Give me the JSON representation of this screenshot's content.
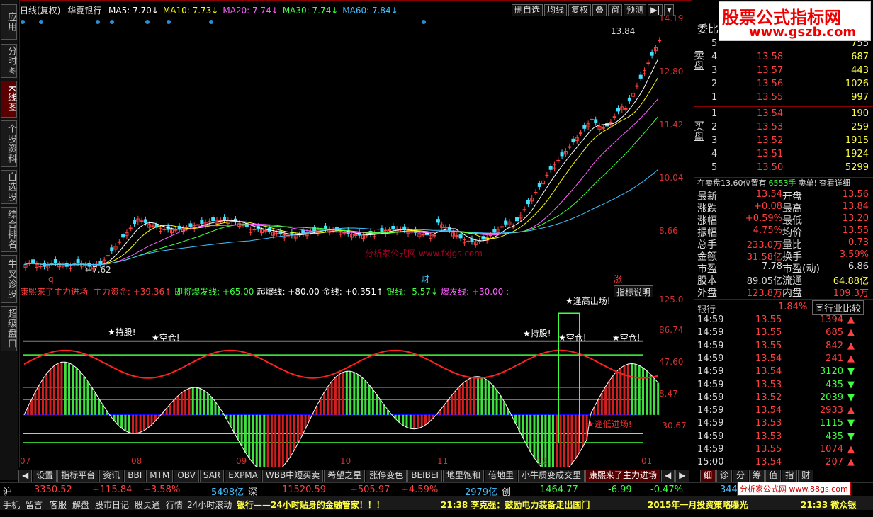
{
  "left_bar": [
    "应用",
    "分时图",
    "K线图",
    "个股资料",
    "自选股",
    "综合排名",
    "牛叉诊股",
    "超级盘口"
  ],
  "header": {
    "period": "日线(复权)",
    "stock_name": "华夏银行",
    "ma": [
      {
        "label": "MA5: 7.70↓",
        "color": "#ffffff"
      },
      {
        "label": "MA10: 7.73↓",
        "color": "#ffff00"
      },
      {
        "label": "MA20: 7.74↓",
        "color": "#ff60ff"
      },
      {
        "label": "MA30: 7.74↓",
        "color": "#40ff40"
      },
      {
        "label": "MA60: 7.84↓",
        "color": "#40c0ff"
      }
    ]
  },
  "toolbar": [
    "删自选",
    "均线",
    "复权",
    "叠",
    "窗",
    "预测"
  ],
  "price_axis": [
    "14.19",
    "12.80",
    "11.42",
    "10.04",
    "8.66"
  ],
  "price_labels": {
    "high": "13.84",
    "low": "7.62"
  },
  "event_markers": [
    "q",
    "财",
    "涨"
  ],
  "indicator": {
    "name": "康熙来了主力进场",
    "items": [
      {
        "label": "主力资金: +39.36↑",
        "color": "#ff4040"
      },
      {
        "label": "即将爆发线: +65.00",
        "color": "#40ff40"
      },
      {
        "label": "起爆线: +80.00",
        "color": "#ffffff"
      },
      {
        "label": "金线: +0.351↑",
        "color": "#ffffff"
      },
      {
        "label": "银线: -5.57↓",
        "color": "#40ff40"
      },
      {
        "label": "爆发线: +30.00 ;",
        "color": "#ff60ff"
      }
    ],
    "button": "指标说明",
    "axis": [
      "125.0",
      "86.74",
      "47.60",
      "8.47",
      "-30.67"
    ],
    "annotations": [
      "★逢高出场!",
      "★空仓!",
      "★空仓!",
      "★空仓!",
      "★逢低进场!",
      "★持股!",
      "★持股!"
    ]
  },
  "months": [
    "07",
    "08",
    "09",
    "10",
    "11",
    "12",
    "01"
  ],
  "watermark_mid": "分析家公式网 www.fxjgs.com",
  "order_book": {
    "header": "委比",
    "sell_label": "卖盘",
    "buy_label": "买盘",
    "sell": [
      {
        "n": "5",
        "p": "",
        "v": "755"
      },
      {
        "n": "4",
        "p": "13.58",
        "v": "687"
      },
      {
        "n": "3",
        "p": "13.57",
        "v": "443"
      },
      {
        "n": "2",
        "p": "13.56",
        "v": "1026"
      },
      {
        "n": "1",
        "p": "13.55",
        "v": "997"
      }
    ],
    "buy": [
      {
        "n": "1",
        "p": "13.54",
        "v": "190"
      },
      {
        "n": "2",
        "p": "13.53",
        "v": "259"
      },
      {
        "n": "3",
        "p": "13.52",
        "v": "1915"
      },
      {
        "n": "4",
        "p": "13.51",
        "v": "1924"
      },
      {
        "n": "5",
        "p": "13.50",
        "v": "5299"
      }
    ],
    "note_a": "在卖盘13.60位置有",
    "note_b": "6553手",
    "note_c": "卖单!",
    "note_d": "查看详细"
  },
  "quote": [
    [
      "最新",
      "13.54",
      "开盘",
      "13.56"
    ],
    [
      "涨跌",
      "+0.08",
      "最高",
      "13.84"
    ],
    [
      "涨幅",
      "+0.59%",
      "最低",
      "13.20"
    ],
    [
      "振幅",
      "4.75%",
      "均价",
      "13.55"
    ],
    [
      "总手",
      "233.0万",
      "量比",
      "0.73"
    ],
    [
      "金额",
      "31.58亿",
      "换手",
      "3.59%"
    ],
    [
      "市盈",
      "7.78",
      "市盈(动)",
      "6.86"
    ],
    [
      "股本",
      "89.05亿",
      "流通",
      "64.88亿"
    ],
    [
      "外盘",
      "123.8万",
      "内盘",
      "109.3万"
    ]
  ],
  "sector": {
    "name": "银行",
    "pct": "1.84%",
    "btn": "同行业比较"
  },
  "ticks": [
    [
      "14:59",
      "13.55",
      "1394"
    ],
    [
      "14:59",
      "13.55",
      "685"
    ],
    [
      "14:59",
      "13.55",
      "842"
    ],
    [
      "14:59",
      "13.54",
      "241"
    ],
    [
      "14:59",
      "13.54",
      "3120"
    ],
    [
      "14:59",
      "13.53",
      "435"
    ],
    [
      "14:59",
      "13.52",
      "2039"
    ],
    [
      "14:59",
      "13.54",
      "2933"
    ],
    [
      "14:59",
      "13.53",
      "1115"
    ],
    [
      "14:59",
      "13.53",
      "435"
    ],
    [
      "14:59",
      "13.55",
      "1074"
    ],
    [
      "15:00",
      "13.54",
      "207"
    ]
  ],
  "tabs": [
    "设置",
    "指标平台",
    "资讯",
    "BBI",
    "MTM",
    "OBV",
    "SAR",
    "EXPMA",
    "WBB中短买卖",
    "希望之星",
    "涨停变色",
    "BEIBEI",
    "地里饱和",
    "倍地里",
    "小牛质变成交里",
    "康熙来了主力进场"
  ],
  "right_tabs": [
    "细",
    "诊",
    "分",
    "筹",
    "值",
    "指",
    "财"
  ],
  "status": {
    "sh_lbl": "沪",
    "sh": "3350.52",
    "sh_chg": "+115.84",
    "sh_pct": "+3.58%",
    "sh_amt": "5498亿",
    "sz_lbl": "深",
    "sz": "11520.59",
    "sz_chg": "+505.97",
    "sz_pct": "+4.59%",
    "sz_amt": "2979亿",
    "cy_lbl": "创",
    "cy": "1464.77",
    "cy_chg": "-6.99",
    "cy_pct": "-0.47%",
    "cy_amt": "344"
  },
  "bottom": {
    "items": [
      "手机",
      "留言",
      "客服",
      "解盘",
      "股市日记",
      "股灵通",
      "行情",
      "24小时滚动"
    ],
    "ticker1": "银行——24小时贴身的金融管家！！！",
    "ticker2": "21:38 李克强：鼓励电力装备走出国门",
    "ticker3": "2015年一月投资策略曝光",
    "ticker4": "21:33 微众银"
  },
  "watermark": {
    "line1": "股票公式指标网",
    "line2": "www.gszb.com",
    "line3": "分析家公式网 www.88gs.com"
  }
}
